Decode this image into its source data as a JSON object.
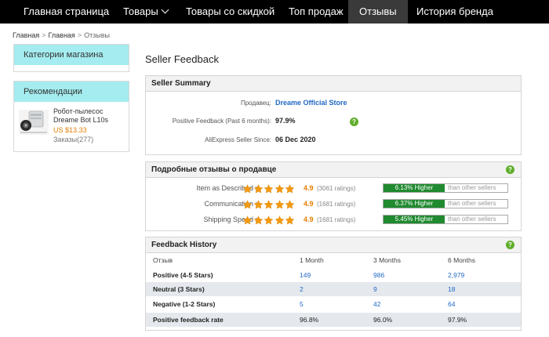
{
  "nav": {
    "items": [
      {
        "label": "Главная страница"
      },
      {
        "label": "Товары"
      },
      {
        "label": "Товары со скидкой"
      },
      {
        "label": "Топ продаж"
      },
      {
        "label": "Отзывы"
      },
      {
        "label": "История бренда"
      }
    ]
  },
  "breadcrumb": {
    "home": "Главная",
    "sep": ">",
    "mid": "Главная",
    "current": "Отзывы"
  },
  "sidebar": {
    "categories_title": "Категории магазина",
    "recommendations_title": "Рекомендации",
    "rec_item": {
      "title": "Робот-пылесос Dreame Bot L10s",
      "price": "US $13.33",
      "orders": "Заказы(277)"
    }
  },
  "page_title": "Seller Feedback",
  "summary": {
    "title": "Seller Summary",
    "seller_label": "Продавец:",
    "seller_name": "Dreame Official Store",
    "positive_label": "Positive Feedback (Past 6 months):",
    "positive_value": "97.9%",
    "since_label": "AliExpress Seller Since:",
    "since_value": "06 Dec 2020"
  },
  "detailed": {
    "title": "Подробные отзывы о продавце",
    "rows": [
      {
        "label": "Item as Described :",
        "score": "4.9",
        "ratings": "(3061 ratings)",
        "higher": "6.13% Higher",
        "rest": "than other sellers",
        "stars": 5
      },
      {
        "label": "Communication :",
        "score": "4.9",
        "ratings": "(1681 ratings)",
        "higher": "6.37% Higher",
        "rest": "than other sellers",
        "stars": 5
      },
      {
        "label": "Shipping Speed :",
        "score": "4.9",
        "ratings": "(1681 ratings)",
        "higher": "5.45% Higher",
        "rest": "than other sellers",
        "stars": 5
      }
    ]
  },
  "history": {
    "title": "Feedback History",
    "headers": [
      "Отзыв",
      "1 Month",
      "3 Months",
      "6 Months"
    ],
    "rows": [
      {
        "label": "Positive (4-5 Stars)",
        "m1": "149",
        "m3": "986",
        "m6": "2,979"
      },
      {
        "label": "Neutral (3 Stars)",
        "m1": "2",
        "m3": "9",
        "m6": "18"
      },
      {
        "label": "Negative (1-2 Stars)",
        "m1": "5",
        "m3": "42",
        "m6": "64"
      },
      {
        "label": "Positive feedback rate",
        "m1": "96.8%",
        "m3": "96.0%",
        "m6": "97.9%"
      }
    ]
  },
  "colors": {
    "nav_bg": "#000000",
    "accent_cyan": "#a4ecef",
    "link_blue": "#2169c4",
    "orange": "#e77e00",
    "green": "#1f8a2f"
  }
}
